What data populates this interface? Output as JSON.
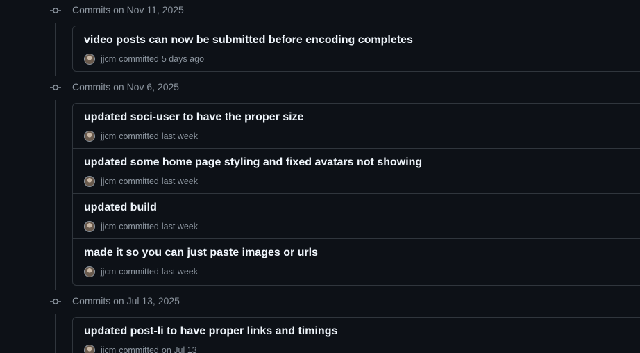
{
  "groups": [
    {
      "date_label": "Commits on Nov 11, 2025",
      "commits": [
        {
          "title": "video posts can now be submitted before encoding completes",
          "author": "jjcm",
          "action": "committed",
          "time": "5 days ago"
        }
      ]
    },
    {
      "date_label": "Commits on Nov 6, 2025",
      "commits": [
        {
          "title": "updated soci-user to have the proper size",
          "author": "jjcm",
          "action": "committed",
          "time": "last week"
        },
        {
          "title": "updated some home page styling and fixed avatars not showing",
          "author": "jjcm",
          "action": "committed",
          "time": "last week"
        },
        {
          "title": "updated build",
          "author": "jjcm",
          "action": "committed",
          "time": "last week"
        },
        {
          "title": "made it so you can just paste images or urls",
          "author": "jjcm",
          "action": "committed",
          "time": "last week"
        }
      ]
    },
    {
      "date_label": "Commits on Jul 13, 2025",
      "commits": [
        {
          "title": "updated post-li to have proper links and timings",
          "author": "jjcm",
          "action": "committed",
          "time": "on Jul 13"
        }
      ]
    }
  ],
  "icons": {
    "group_marker": "git-commit-icon",
    "avatar": "user-avatar"
  },
  "colors": {
    "background": "#0d1117",
    "border": "#30363d",
    "muted_text": "#8d96a0",
    "title_text": "#f0f6fc"
  }
}
